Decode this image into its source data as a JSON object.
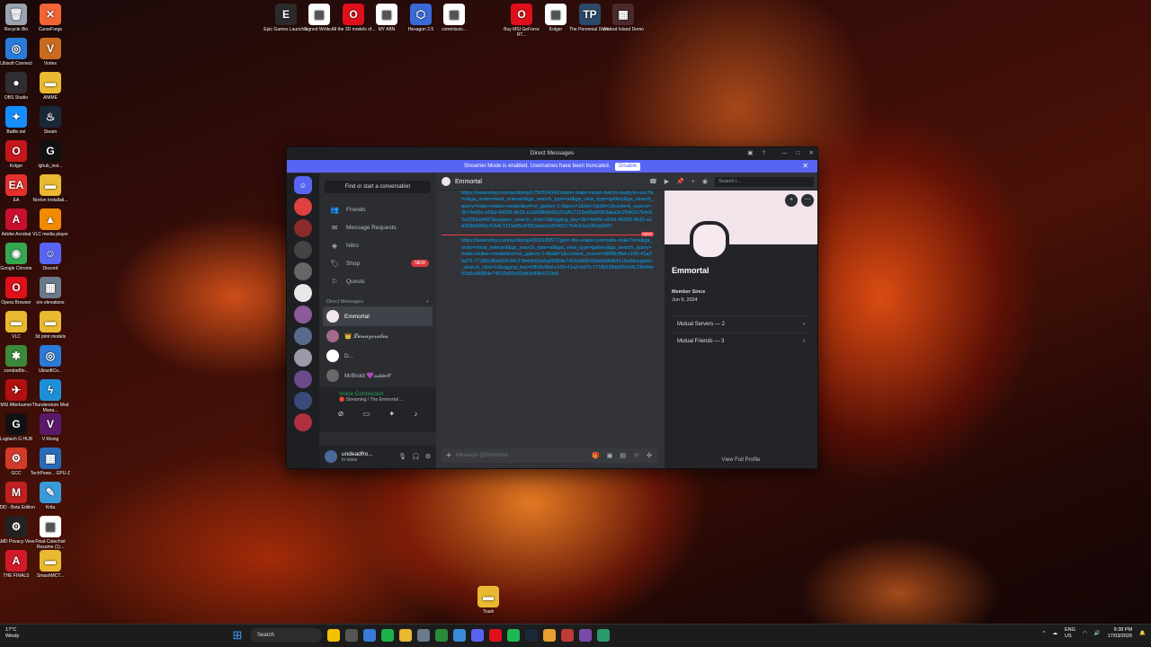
{
  "desktop": {
    "icons": [
      {
        "label": "Recycle Bin",
        "color": "#9aa4b2",
        "glyph": "🗑"
      },
      {
        "label": "CurseForge",
        "color": "#f16436",
        "glyph": "✕"
      },
      {
        "label": "Ubisoft Connect",
        "color": "#2a7bd8",
        "glyph": "◎"
      },
      {
        "label": "Vortex",
        "color": "#c86b1e",
        "glyph": "V"
      },
      {
        "label": "OBS Studio",
        "color": "#302e31",
        "glyph": "●"
      },
      {
        "label": "ANIME",
        "color": "#e8b931",
        "glyph": "▬"
      },
      {
        "label": "Battle.net",
        "color": "#148eff",
        "glyph": "✦"
      },
      {
        "label": "Steam",
        "color": "#1b2838",
        "glyph": "♨"
      },
      {
        "label": "Kolger",
        "color": "#c4161c",
        "glyph": "O"
      },
      {
        "label": "lghub_inst...",
        "color": "#111111",
        "glyph": "G"
      },
      {
        "label": "EA",
        "color": "#e4312b",
        "glyph": "EA"
      },
      {
        "label": "Norton Installati...",
        "color": "#e8b931",
        "glyph": "▬"
      },
      {
        "label": "Adobe Acrobat",
        "color": "#c8102e",
        "glyph": "A"
      },
      {
        "label": "VLC media player",
        "color": "#f08a00",
        "glyph": "▲"
      },
      {
        "label": "Google Chrome",
        "color": "#34a853",
        "glyph": "◉"
      },
      {
        "label": "Discord",
        "color": "#5865f2",
        "glyph": "☺"
      },
      {
        "label": "Opera Browser",
        "color": "#e0101b",
        "glyph": "O"
      },
      {
        "label": "ore elevations",
        "color": "#6a7a8a",
        "glyph": "▦"
      },
      {
        "label": "VLC",
        "color": "#e8b931",
        "glyph": "▬"
      },
      {
        "label": "3d print models",
        "color": "#e8b931",
        "glyph": "▬"
      },
      {
        "label": "zombieBlo...",
        "color": "#3a8a3a",
        "glyph": "✱"
      },
      {
        "label": "UbisoftCo...",
        "color": "#2a7bd8",
        "glyph": "◎"
      },
      {
        "label": "MSI Afterburner",
        "color": "#b01010",
        "glyph": "✈"
      },
      {
        "label": "Thunderstore Mod Mana...",
        "color": "#1f8fd8",
        "glyph": "ϟ"
      },
      {
        "label": "Logitech G HUB",
        "color": "#111111",
        "glyph": "G"
      },
      {
        "label": "V Rising",
        "color": "#5a1a6a",
        "glyph": "V"
      },
      {
        "label": "GCC",
        "color": "#d23a2a",
        "glyph": "⚙"
      },
      {
        "label": "TechPowe... GPU-Z",
        "color": "#2a6ab8",
        "glyph": "▦"
      },
      {
        "label": "M3D - Beta Edition",
        "color": "#c02020",
        "glyph": "M"
      },
      {
        "label": "Krita",
        "color": "#3a9ad8",
        "glyph": "✎"
      },
      {
        "label": "AMD Privacy View",
        "color": "#222222",
        "glyph": "⚙"
      },
      {
        "label": "Final-Catechist Resume (1)...",
        "color": "#ffffff",
        "glyph": "▤"
      },
      {
        "label": "THE FINALS",
        "color": "#d01a2a",
        "glyph": "A"
      },
      {
        "label": "SmashMCT...",
        "color": "#e8b931",
        "glyph": "▬"
      },
      {
        "label": "Epic Games Launcher",
        "color": "#2a2a2a",
        "glyph": "E"
      },
      {
        "label": "Signed Writte...",
        "color": "#ffffff",
        "glyph": "▤"
      },
      {
        "label": "All the 3D models of...",
        "color": "#e0101b",
        "glyph": "O"
      },
      {
        "label": "MY ABN",
        "color": "#ffffff",
        "glyph": "▤"
      },
      {
        "label": "Hexagon 2.5",
        "color": "#3a6ad8",
        "glyph": "⬡"
      },
      {
        "label": "commissio...",
        "color": "#ffffff",
        "glyph": "▤"
      },
      {
        "label": "Buy MSI GeForce RT...",
        "color": "#e0101b",
        "glyph": "O"
      },
      {
        "label": "Kolger",
        "color": "#ffffff",
        "glyph": "▤"
      },
      {
        "label": "The Perennial Demo",
        "color": "#2a4a6a",
        "glyph": "TP"
      },
      {
        "label": "Wicked Island Demo",
        "color": "#4a2a2a",
        "glyph": "▦"
      }
    ],
    "recycle": "Trash"
  },
  "window": {
    "title": "Direct Messages",
    "streamer_text": "Streamer Mode is enabled. Usernames have been truncated.",
    "disable_label": "Disable"
  },
  "sidebar": {
    "find_placeholder": "Find or start a conversation",
    "nav": [
      {
        "icon": "👥",
        "label": "Friends"
      },
      {
        "icon": "✉",
        "label": "Message Requests"
      },
      {
        "icon": "◈",
        "label": "Nitro"
      },
      {
        "icon": "🏷",
        "label": "Shop",
        "badge": "NEW"
      },
      {
        "icon": "⚐",
        "label": "Quests"
      }
    ],
    "dm_header": "Direct Messages",
    "dms": [
      {
        "name": "Emmortal",
        "active": true,
        "color": "#f1e4ea"
      },
      {
        "name": "👑 𝓛𝓾𝓷𝓪𝔃𝓮𝓻𝓪𝓵𝓮𝓪",
        "active": false,
        "color": "#a46a8a"
      },
      {
        "name": "D...",
        "active": false,
        "color": "#ffffff"
      },
      {
        "name": "MrBiskit 💜𝒶𝒹𝒹𝓊𝓁𝓉",
        "active": false,
        "color": "#6a6a6a"
      }
    ],
    "voice": {
      "title": "Voice Connected",
      "sub": "🔴 Streaming / The Emmortal ..."
    },
    "user": {
      "name": "undeadfro...",
      "status": "In voice"
    }
  },
  "chat": {
    "recipient": "Emmortal",
    "search_placeholder": "Search i...",
    "messages": [
      "https://www.etsy.com/au/listing/1750534342/vtuber-male-model-live2d-ready-to-use?ls=s&ga_order=most_relevant&ga_search_type=all&ga_view_type=gallery&ga_search_query=male+vtuber+model&ref=sr_gallery-1-9&pro=1&sts=1&dd=1&content_source=3b74e69c-e55d-40039-9b15-a1d309b696b1%3ALT119e85a5f353aba2e2546317b4c62a1063a0497&organic_search_click=1&logging_key=3b74e69c-e55d-40039-9b15-a1d309b696b1%3ALT119e85a5f353aba2e2546317b4c62a1063a0497",
      "https://www.etsy.com/au/listing/4369189577/grim-the-reaper-premade-male?ls=s&ga_order=most_relevant&ga_search_type=all&ga_view_type=gallery&ga_search_query=male+vtuber+model&ref=sr_gallery-2-4&dd=1&content_source=0808c9bd-c100-41a2-bd75-771fb53fbb03%3ALT9b44e53a5a36854e74010d00c02dd3d49b4119a9&organic_search_click=1&logging_key=0808c9bd-c100-41a2-bd75-771fb53fbb03%3ALT9b44e53a5a36854e74010d00c02dd3d49b4119a9"
    ],
    "new_label": "NEW",
    "composer_placeholder": "Message @Emmortal"
  },
  "profile": {
    "name": "Emmortal",
    "member_since_label": "Member Since",
    "member_since": "Jun 9, 2024",
    "mutual_servers": "Mutual Servers — 2",
    "mutual_friends": "Mutual Friends — 3",
    "view_full": "View Full Profile"
  },
  "taskbar": {
    "weather_temp": "17°C",
    "weather_desc": "Windy",
    "search": "Search",
    "lang": "ENG",
    "region": "US",
    "time": "9:38 PM",
    "date": "17/03/2026"
  }
}
